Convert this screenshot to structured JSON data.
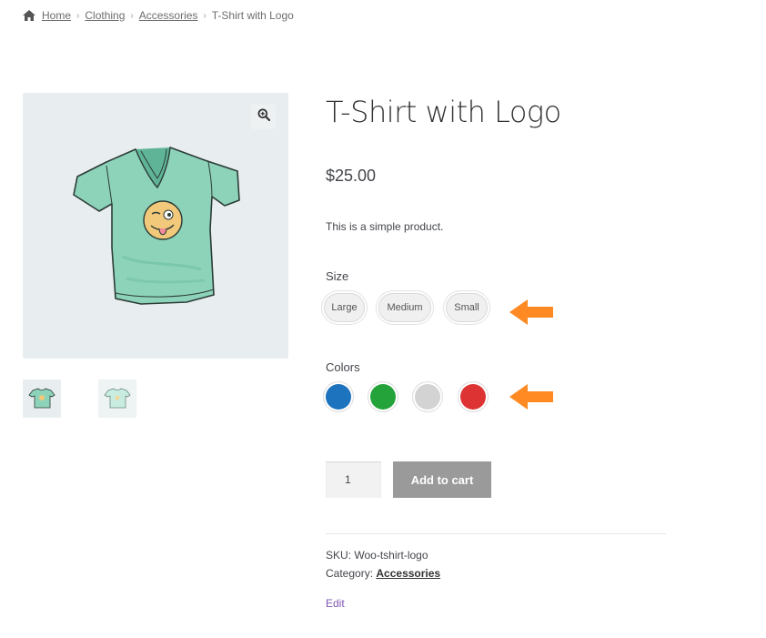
{
  "breadcrumb": {
    "home_icon": "home-icon",
    "separator": "›",
    "items": [
      "Home",
      "Clothing",
      "Accessories"
    ],
    "current": "T-Shirt with Logo"
  },
  "gallery": {
    "main_image": "t-shirt-with-logo-image",
    "zoom_icon": "magnifier-plus-icon",
    "thumbnails": [
      "t-shirt-thumbnail-front",
      "t-shirt-thumbnail-back"
    ]
  },
  "product": {
    "title": "T-Shirt with Logo",
    "price": "$25.00",
    "description": "This is a simple product."
  },
  "size": {
    "label": "Size",
    "options": [
      "Large",
      "Medium",
      "Small"
    ]
  },
  "colors": {
    "label": "Colors",
    "options": [
      {
        "color": "#1e73be"
      },
      {
        "color": "#24a33a"
      },
      {
        "color": "#d3d3d3"
      },
      {
        "color": "#dd3333"
      }
    ]
  },
  "arrow_color": "#ff8a24",
  "cart": {
    "quantity": "1",
    "button": "Add to cart",
    "button_color": "#9a9a9a"
  },
  "meta": {
    "sku_label": "SKU:",
    "sku": "Woo-tshirt-logo",
    "category_label": "Category:",
    "category": "Accessories",
    "edit": "Edit"
  }
}
